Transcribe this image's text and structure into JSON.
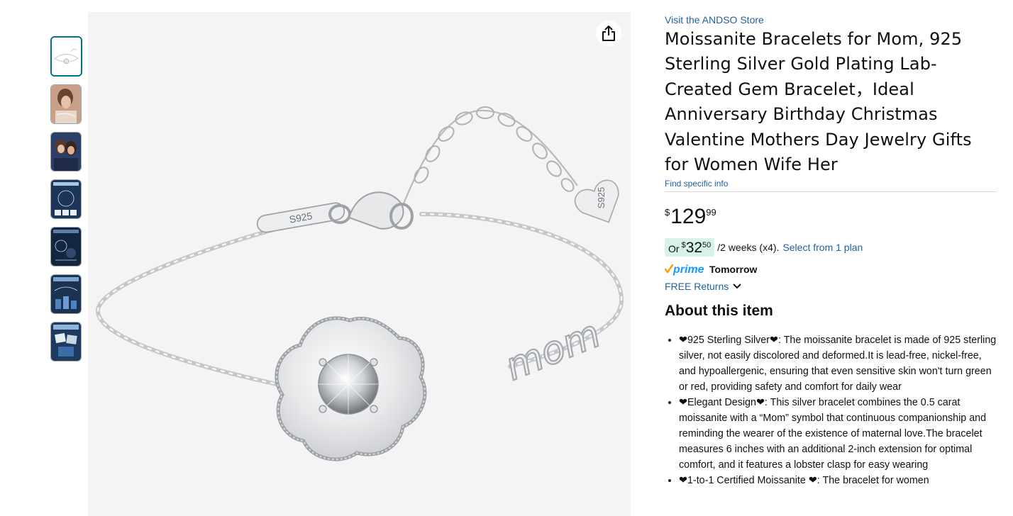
{
  "thumbnails": [
    {
      "label": "bracelet-product-shot",
      "selected": true
    },
    {
      "label": "woman-wearing-bracelet",
      "selected": false
    },
    {
      "label": "mother-daughter-photo",
      "selected": false
    },
    {
      "label": "size-info-graphic",
      "selected": false
    },
    {
      "label": "detail-graphic",
      "selected": false
    },
    {
      "label": "certificate-graphic",
      "selected": false
    },
    {
      "label": "gift-package-graphic",
      "selected": false
    }
  ],
  "image": {
    "clasp_engraving": "S925",
    "heart_engraving": "S925",
    "charm_word": "mom"
  },
  "product": {
    "store_link": "Visit the ANDSO Store",
    "title": "Moissanite Bracelets for Mom, 925 Sterling Silver Gold Plating Lab-Created Gem Bracelet，Ideal Anniversary Birthday Christmas Valentine Mothers Day Jewelry Gifts for Women Wife Her",
    "find_info": "Find specific info"
  },
  "price": {
    "symbol": "$",
    "whole": "129",
    "fraction": "99"
  },
  "installment": {
    "prefix": "Or",
    "symbol": "$",
    "whole": "32",
    "fraction": "50",
    "rest": "/2 weeks (x4).",
    "link": "Select from 1 plan",
    "badge_color": "#d7f2e8"
  },
  "delivery": {
    "prime_label": "prime",
    "day": "Tomorrow"
  },
  "returns": {
    "label": "FREE Returns"
  },
  "about": {
    "heading": "About this item",
    "bullets": [
      "❤925 Sterling Silver❤: The moissanite bracelet is made of 925 sterling silver, not easily discolored and deformed.It is lead-free, nickel-free, and hypoallergenic, ensuring that even sensitive skin won't turn green or red, providing safety and comfort for daily wear",
      "❤Elegant Design❤: This silver bracelet combines the 0.5 carat moissanite with a “Mom” symbol that continuous companionship and reminding the wearer of the existence of maternal love.The bracelet measures 6 inches with an additional 2-inch extension for optimal comfort, and it features a lobster clasp for easy wearing",
      "❤1-to-1 Certified Moissanite ❤: The bracelet for women"
    ]
  },
  "colors": {
    "link": "#2162a1",
    "thumb_selected_border": "#007185",
    "prime_check": "#ff9900",
    "prime_text": "#1399ff",
    "image_bg": "#f4f4f4"
  }
}
